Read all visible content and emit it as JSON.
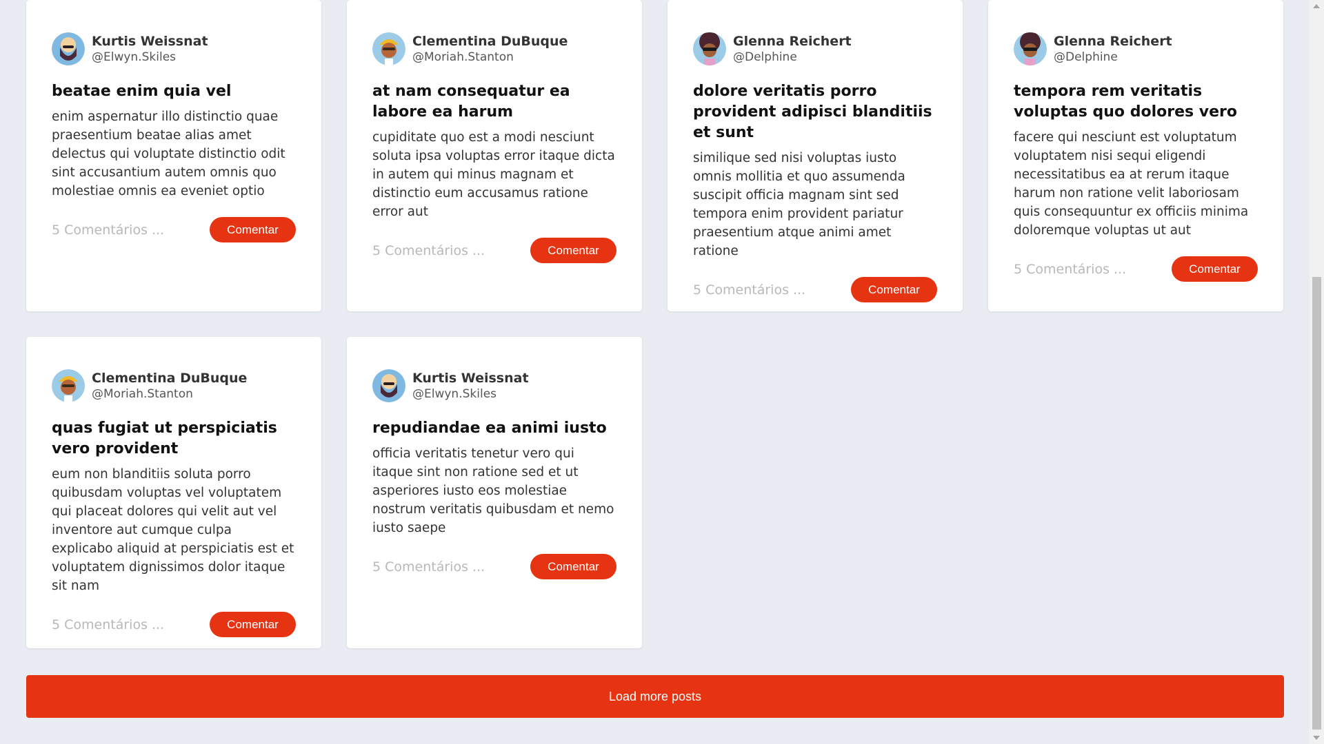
{
  "posts": [
    {
      "author_name": "Kurtis Weissnat",
      "author_handle": "@Elwyn.Skiles",
      "avatar_icon": "bald-bearded-man-avatar-icon",
      "title": "beatae enim quia vel",
      "body": "enim aspernatur illo distinctio quae praesentium beatae alias amet delectus qui voluptate distinctio odit sint accusantium autem omnis quo molestiae omnis ea eveniet optio",
      "comments": "5 Comentários ...",
      "button": "Comentar"
    },
    {
      "author_name": "Clementina DuBuque",
      "author_handle": "@Moriah.Stanton",
      "avatar_icon": "yellow-cap-man-avatar-icon",
      "title": "at nam consequatur ea labore ea harum",
      "body": "cupiditate quo est a modi nesciunt soluta ipsa voluptas error itaque dicta in autem qui minus magnam et distinctio eum accusamus ratione error aut",
      "comments": "5 Comentários ...",
      "button": "Comentar"
    },
    {
      "author_name": "Glenna Reichert",
      "author_handle": "@Delphine",
      "avatar_icon": "afro-sunglasses-avatar-icon",
      "title": "dolore veritatis porro provident adipisci blanditiis et sunt",
      "body": "similique sed nisi voluptas iusto omnis mollitia et quo assumenda suscipit officia magnam sint sed tempora enim provident pariatur praesentium atque animi amet ratione",
      "comments": "5 Comentários ...",
      "button": "Comentar"
    },
    {
      "author_name": "Glenna Reichert",
      "author_handle": "@Delphine",
      "avatar_icon": "afro-sunglasses-avatar-icon",
      "title": "tempora rem veritatis voluptas quo dolores vero",
      "body": "facere qui nesciunt est voluptatum voluptatem nisi sequi eligendi necessitatibus ea at rerum itaque harum non ratione velit laboriosam quis consequuntur ex officiis minima doloremque voluptas ut aut",
      "comments": "5 Comentários ...",
      "button": "Comentar"
    },
    {
      "author_name": "Clementina DuBuque",
      "author_handle": "@Moriah.Stanton",
      "avatar_icon": "yellow-cap-man-avatar-icon",
      "title": "quas fugiat ut perspiciatis vero provident",
      "body": "eum non blanditiis soluta porro quibusdam voluptas vel voluptatem qui placeat dolores qui velit aut vel inventore aut cumque culpa explicabo aliquid at perspiciatis est et voluptatem dignissimos dolor itaque sit nam",
      "comments": "5 Comentários ...",
      "button": "Comentar"
    },
    {
      "author_name": "Kurtis Weissnat",
      "author_handle": "@Elwyn.Skiles",
      "avatar_icon": "bald-bearded-man-avatar-icon",
      "title": "repudiandae ea animi iusto",
      "body": "officia veritatis tenetur vero qui itaque sint non ratione sed et ut asperiores iusto eos molestiae nostrum veritatis quibusdam et nemo iusto saepe",
      "comments": "5 Comentários ...",
      "button": "Comentar"
    }
  ],
  "load_more_label": "Load more posts",
  "colors": {
    "accent": "#e63312",
    "background": "#e9ecf2",
    "card": "#ffffff",
    "muted_text": "#b8b8b8"
  }
}
